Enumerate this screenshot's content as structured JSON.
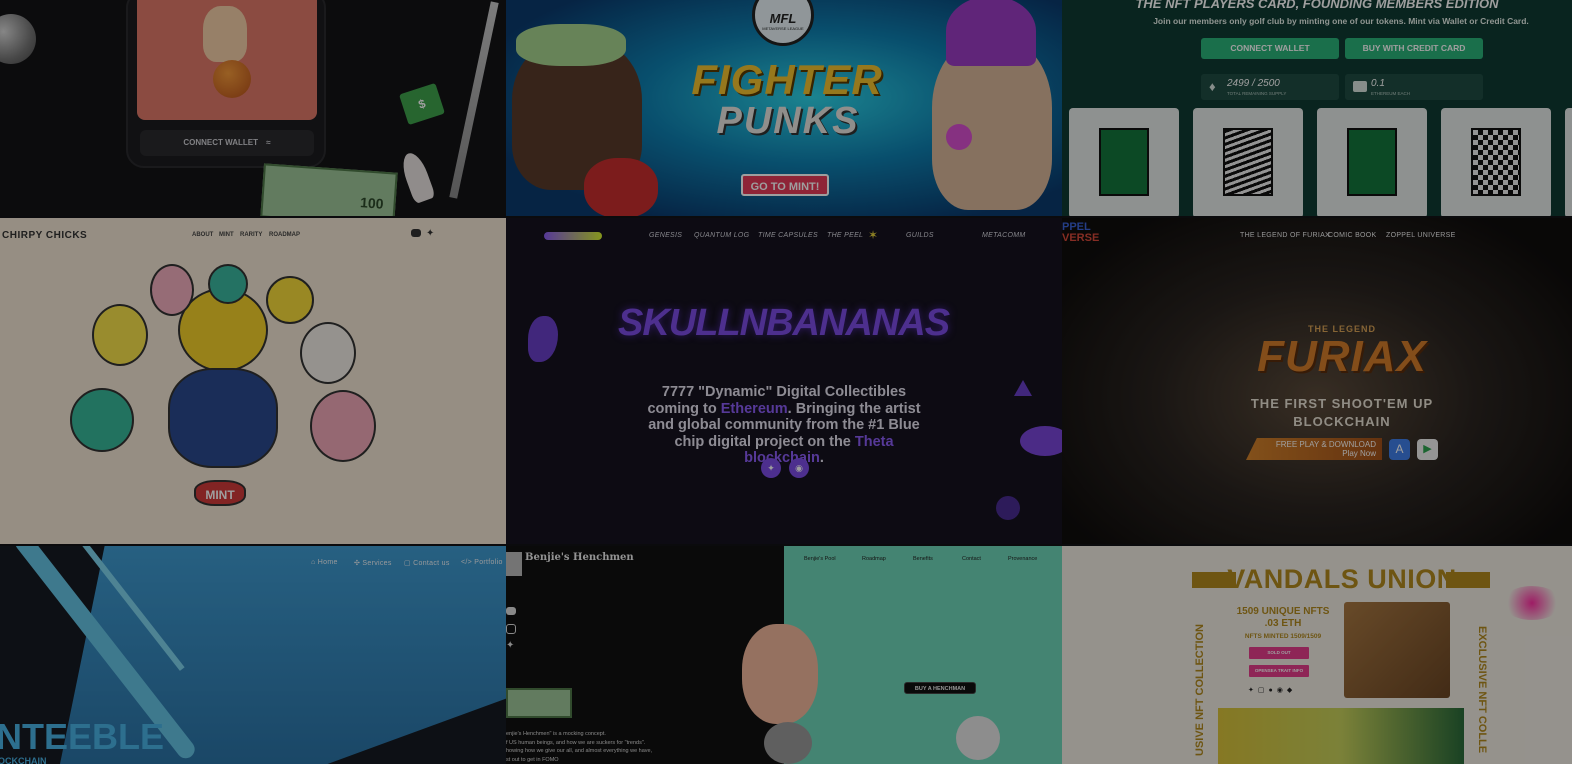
{
  "tile1": {
    "connect_label": "CONNECT WALLET",
    "bill_label": "100",
    "dollar_label": "$"
  },
  "tile2": {
    "badge_text": "MFL",
    "badge_ring": "METAVERSE LEAGUE",
    "title_line1": "FIGHTER",
    "title_line2": "PUNKS",
    "cta": "GO TO MINT!"
  },
  "tile3": {
    "heading": "THE NFT PLAYERS CARD, FOUNDING MEMBERS EDITION",
    "subtitle": "Join our members only golf club by minting one of our tokens. Mint via Wallet or Credit Card.",
    "connect_wallet": "CONNECT WALLET",
    "buy_credit": "BUY WITH CREDIT CARD",
    "supply_value": "2499 / 2500",
    "supply_caption": "TOTAL REMAINING SUPPLY",
    "price_value": "0.1",
    "price_caption": "ETHEREUM EACH"
  },
  "tile4": {
    "logo": "CHIRPY CHICKS",
    "nav": [
      "ABOUT",
      "MINT",
      "RARITY",
      "ROADMAP"
    ],
    "mint_button": "MINT"
  },
  "tile5": {
    "nav": [
      "GENESIS",
      "QUANTUM LOG",
      "TIME CAPSULES",
      "THE PEEL",
      "GUILDS",
      "METACOMM"
    ],
    "title": "SKULLNBANANAS",
    "desc_part1": "7777 \"Dynamic\" Digital Collectibles coming to ",
    "desc_link1": "Ethereum",
    "desc_part2": ". Bringing the artist and global community from the #1 Blue chip digital project on the ",
    "desc_link2": "Theta blockchain",
    "desc_part3": ".",
    "accent": "#8b5cf6"
  },
  "tile6": {
    "logo_line1": "PPEL",
    "logo_line2": "VERSE",
    "nav": [
      "THE LEGEND OF FURIAX",
      "COMIC BOOK",
      "ZOPPEL UNIVERSE"
    ],
    "pretitle": "THE LEGEND",
    "title": "FURIAX",
    "tagline1": "THE FIRST SHOOT'EM UP",
    "tagline2": "BLOCKCHAIN",
    "play_line1": "FREE PLAY & DOWNLOAD",
    "play_line2": "Play Now"
  },
  "tile7": {
    "nav": [
      "Home",
      "Services",
      "Contact us",
      "Portfolio"
    ],
    "brand": "NTEEBLE",
    "sub": "OCKCHAIN"
  },
  "tile8": {
    "brand": "Benjie's Henchmen",
    "nav": [
      "Benjie's Pool",
      "Roadmap",
      "Benefits",
      "Contact",
      "Provenance"
    ],
    "cta": "BUY A HENCHMAN",
    "body_line1": "enjie's Henchmen\" is a mocking concept.",
    "body_line2": "f US human beings, and how we are suckers for \"trends\".",
    "body_line3": "howing how we give our all, and almost everything we have,",
    "body_line4": "st out to get in FOMO"
  },
  "tile9": {
    "title": "VANDALS UNION",
    "line1": "1509 UNIQUE NFTS",
    "line2": ".03 ETH",
    "line3": "NFTS MINTED 1509/1509",
    "btn1": "SOLD OUT",
    "btn2": "OPENSEA TRAIT INFO",
    "side_left": "USIVE NFT COLLECTION",
    "side_right": "EXCLUSIVE NFT COLLE"
  }
}
